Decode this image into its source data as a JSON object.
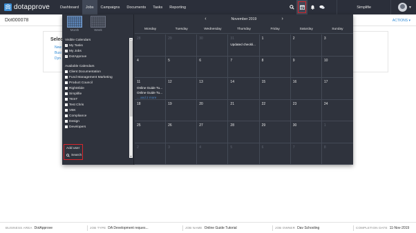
{
  "brand": {
    "name": "dotapprove",
    "color": "#3b8ed6"
  },
  "nav": {
    "links": [
      "Dashboard",
      "Jobs",
      "Campaigns",
      "Documents",
      "Tasks",
      "Reporting"
    ],
    "active_index": 1,
    "icons": [
      "search-icon",
      "calendar-icon",
      "bell-icon",
      "chat-icon"
    ],
    "user": "Simplifie"
  },
  "page": {
    "title": "Dot000078",
    "actions_label": "ACTIONS ▾",
    "card_title": "Select",
    "card_links": [
      "New",
      "Busi",
      "Dyn"
    ]
  },
  "calendar": {
    "view_buttons": [
      "Month",
      "Week"
    ],
    "visible_header": "Visible Calendars",
    "visible": [
      {
        "label": "My Tasks",
        "checked": true
      },
      {
        "label": "My Jobs",
        "checked": true
      },
      {
        "label": "DotApprove",
        "checked": true
      }
    ],
    "available_header": "Available Calendars",
    "available": [
      "Client Documentation",
      "Fund Management Marketing",
      "Product Council",
      "RightSlide",
      "Simplifie",
      "TEST",
      "Test Chris",
      "VBK",
      "Compliance",
      "Design",
      "Developers"
    ],
    "add_user": "Add user",
    "search": "Search",
    "month_label": "November 2019",
    "prev": "‹",
    "next": "›",
    "day_headers": [
      "Monday",
      "Tuesday",
      "Wednesday",
      "Thursday",
      "Friday",
      "Saturday",
      "Sunday"
    ],
    "weeks": [
      [
        {
          "d": "28",
          "dim": true
        },
        {
          "d": "29",
          "dim": true
        },
        {
          "d": "30",
          "dim": true
        },
        {
          "d": "31",
          "dim": true,
          "events": [
            "Updated checkli..."
          ]
        },
        {
          "d": "1"
        },
        {
          "d": "2"
        },
        {
          "d": "3"
        }
      ],
      [
        {
          "d": "4"
        },
        {
          "d": "5"
        },
        {
          "d": "6"
        },
        {
          "d": "7"
        },
        {
          "d": "8"
        },
        {
          "d": "9"
        },
        {
          "d": "10"
        }
      ],
      [
        {
          "d": "11",
          "events": [
            "Online Guide Tu...",
            "Online Guide Tu..."
          ],
          "more": "... and 2 more"
        },
        {
          "d": "12"
        },
        {
          "d": "13"
        },
        {
          "d": "14"
        },
        {
          "d": "15"
        },
        {
          "d": "16"
        },
        {
          "d": "17"
        }
      ],
      [
        {
          "d": "18"
        },
        {
          "d": "19"
        },
        {
          "d": "20"
        },
        {
          "d": "21"
        },
        {
          "d": "22"
        },
        {
          "d": "23"
        },
        {
          "d": "24"
        }
      ],
      [
        {
          "d": "25"
        },
        {
          "d": "26"
        },
        {
          "d": "27"
        },
        {
          "d": "28"
        },
        {
          "d": "29"
        },
        {
          "d": "30"
        },
        {
          "d": "1",
          "dim": true
        }
      ],
      [
        {
          "d": "2",
          "dim": true
        },
        {
          "d": "3",
          "dim": true
        },
        {
          "d": "4",
          "dim": true
        },
        {
          "d": "5",
          "dim": true
        },
        {
          "d": "6",
          "dim": true
        },
        {
          "d": "7",
          "dim": true
        },
        {
          "d": "8",
          "dim": true
        }
      ]
    ]
  },
  "footer": [
    {
      "key": "BUSINESS AREA",
      "value": "DotApprove"
    },
    {
      "key": "JOB TYPE",
      "value": "DA Development reques..."
    },
    {
      "key": "JOB NAME",
      "value": "Online Guide Tutorial"
    },
    {
      "key": "JOB OWNER",
      "value": "Dav Schooling"
    },
    {
      "key": "COMPLETION DATE",
      "value": "11-Nov-2019"
    }
  ]
}
